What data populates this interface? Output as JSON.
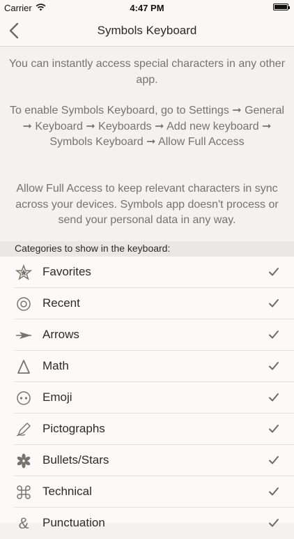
{
  "status_bar": {
    "carrier": "Carrier",
    "time": "4:47 PM",
    "battery_percent": 100
  },
  "nav": {
    "title": "Symbols Keyboard"
  },
  "info": {
    "p1": "You can instantly access special characters in any other app.",
    "p2": "To enable Symbols Keyboard, go to Settings ➞ General ➞ Keyboard ➞ Keyboards ➞ Add new keyboard ➞ Symbols Keyboard ➞ Allow Full Access",
    "p3": "Allow Full Access to keep relevant characters in sync across your devices. Symbols app doesn't process or send your personal data in any way."
  },
  "categories": {
    "header": "Categories to show in the keyboard:",
    "items": [
      {
        "label": "Favorites",
        "icon": "star-icon",
        "checked": true
      },
      {
        "label": "Recent",
        "icon": "target-icon",
        "checked": true
      },
      {
        "label": "Arrows",
        "icon": "arrow-icon",
        "checked": true
      },
      {
        "label": "Math",
        "icon": "delta-icon",
        "checked": true
      },
      {
        "label": "Emoji",
        "icon": "face-icon",
        "checked": true
      },
      {
        "label": "Pictographs",
        "icon": "pen-icon",
        "checked": true
      },
      {
        "label": "Bullets/Stars",
        "icon": "asterisk-icon",
        "checked": true
      },
      {
        "label": "Technical",
        "icon": "command-icon",
        "checked": true
      },
      {
        "label": "Punctuation",
        "icon": "ampersand-icon",
        "checked": true
      }
    ]
  },
  "colors": {
    "background": "#f4f2ee",
    "text": "#2b2b2b",
    "muted": "#77736c",
    "check": "#6e6a63"
  }
}
